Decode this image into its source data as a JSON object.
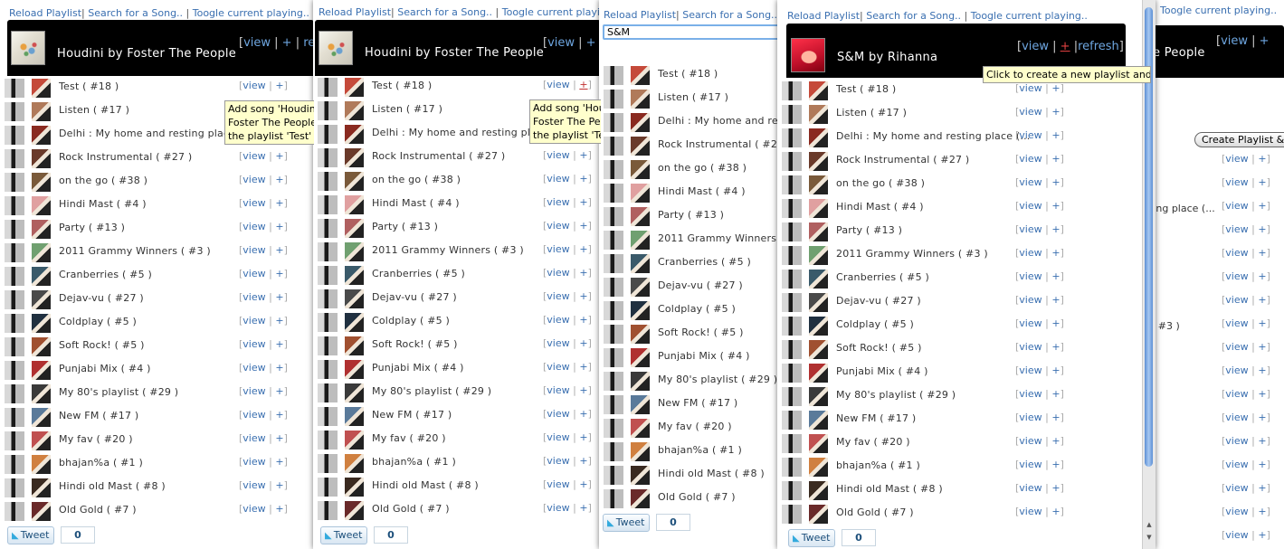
{
  "toolbar": {
    "reload": "Reload Playlist",
    "search": "Search for a Song..",
    "toggle": "Toogle current playing.."
  },
  "header_links": {
    "view": "view",
    "add": "+",
    "refresh": "refresh"
  },
  "now_playing": {
    "houdini": "Houdini by Foster The People",
    "sm": "S&M by Rihanna"
  },
  "search_value": "S&M",
  "row_actions": {
    "view": "view",
    "add": "+"
  },
  "playlists": [
    {
      "label": "Test ( #18 )"
    },
    {
      "label": "Listen ( #17 )"
    },
    {
      "label": "Delhi : My home and resting place (..."
    },
    {
      "label": "Rock Instrumental ( #27 )"
    },
    {
      "label": "on the go ( #38 )"
    },
    {
      "label": "Hindi Mast ( #4 )"
    },
    {
      "label": "Party ( #13 )"
    },
    {
      "label": "2011 Grammy Winners ( #3 )"
    },
    {
      "label": "Cranberries ( #5 )"
    },
    {
      "label": "Dejav-vu ( #27 )"
    },
    {
      "label": "Coldplay ( #5 )"
    },
    {
      "label": "Soft Rock! ( #5 )"
    },
    {
      "label": "Punjabi Mix ( #4 )"
    },
    {
      "label": "My 80's playlist ( #29 )"
    },
    {
      "label": "New FM ( #17 )"
    },
    {
      "label": "My fav ( #20 )"
    },
    {
      "label": "bhajan%a ( #1 )"
    },
    {
      "label": "Hindi old Mast ( #8 )"
    },
    {
      "label": "Old Gold ( #7 )"
    }
  ],
  "icon_colors": [
    "#c54a3a",
    "#b07a5a",
    "#8a2a20",
    "#6a3a2a",
    "#7a5a3a",
    "#e0a0a0",
    "#b06060",
    "#70a070",
    "#3a5a6a",
    "#4a4a4a",
    "#203040",
    "#a05030",
    "#b03030",
    "#3a3a3a",
    "#5a7a9a",
    "#c05050",
    "#d08040",
    "#3a2a20",
    "#6a2a2a"
  ],
  "tooltips": {
    "add_song": "Add song 'Houdini by Foster The People' to the playlist 'Test'",
    "create_playlist": "Click to create a new playlist and add this song"
  },
  "create_playlist_button": "Create Playlist &",
  "fragments": {
    "place": "ting place (...",
    "three": "( #3 )",
    "people": "e People"
  },
  "tweet": {
    "label": "Tweet",
    "count": "0"
  }
}
